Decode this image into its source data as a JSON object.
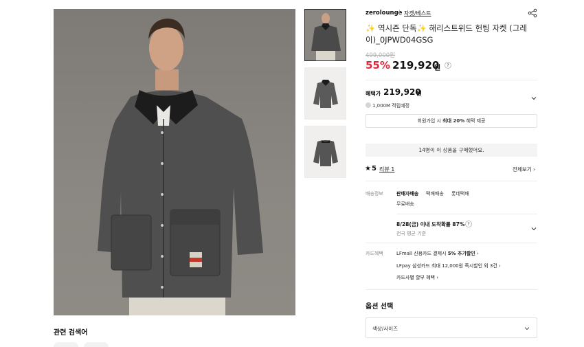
{
  "product": {
    "brand": "zerolounge",
    "breadcrumb": "자켓/베스트",
    "title": "✨ 역시즌 단독✨ 해리스트위드 헌팅 자켓 (그레이)_0JPWD04GSG",
    "original_price": "499,000원",
    "discount": "55%",
    "price": "219,920",
    "price_unit": "원"
  },
  "benefit": {
    "label": "혜택가",
    "price": "219,920",
    "unit": "원",
    "points": "1,000M 적립예정",
    "member_prefix": "회원가입 시 ",
    "member_bold": "최대 20%",
    "member_suffix": " 혜택 제공"
  },
  "buyers_text": "14명이 이 상품을 구매했어요.",
  "review": {
    "rating": "5",
    "review_label": "리뷰 1",
    "view_all": "전체보기"
  },
  "shipping": {
    "label": "배송정보",
    "tags": [
      "판매자배송",
      "택배배송",
      "롯데택배"
    ],
    "fee": "무료배송",
    "eta": "8/28(금) 이내 도착확률 87%",
    "eta_sub": "전국 평균 기준"
  },
  "card": {
    "label": "카드혜택",
    "line1_prefix": "LFmall 신용카드 결제시 ",
    "line1_bold": "5% 추가할인",
    "line2": "LFpay 삼성카드 최대 12,000원 즉시할인 외 3건",
    "line3": "카드사별 할부 혜택"
  },
  "options": {
    "title": "옵션 선택",
    "select_placeholder": "색상/사이즈"
  },
  "related": {
    "title": "관련 검색어"
  },
  "icons": {
    "share": "share-icon",
    "chevron": "chevron-down-icon",
    "question": "question-icon",
    "star": "star-icon"
  },
  "colors": {
    "discount": "#e4273d",
    "text": "#111111",
    "muted": "#888888"
  }
}
